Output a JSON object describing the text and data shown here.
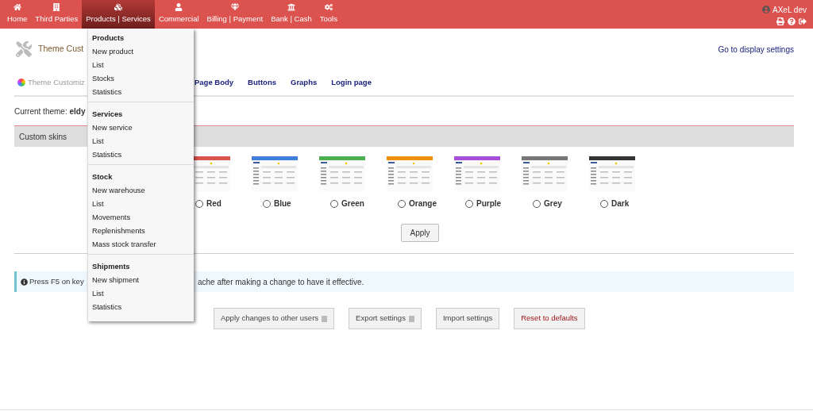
{
  "topbar": {
    "menus": [
      {
        "label": "Home",
        "selected": false
      },
      {
        "label": "Third Parties",
        "selected": false
      },
      {
        "label": "Products | Services",
        "selected": true
      },
      {
        "label": "Commercial",
        "selected": false
      },
      {
        "label": "Billing | Payment",
        "selected": false
      },
      {
        "label": "Bank | Cash",
        "selected": false
      },
      {
        "label": "Tools",
        "selected": false
      }
    ],
    "user": "AXeL dev"
  },
  "page": {
    "title": "Theme Cust",
    "display_settings_link": "Go to display settings",
    "tabs": [
      {
        "label": "Theme Customiz",
        "selected": true
      },
      {
        "label": "Page Body",
        "selected": false
      },
      {
        "label": "Buttons",
        "selected": false
      },
      {
        "label": "Graphs",
        "selected": false
      },
      {
        "label": "Login page",
        "selected": false
      }
    ],
    "current_theme_label": "Current theme:",
    "current_theme": "eldy",
    "section_title": "Custom skins",
    "skins": [
      {
        "label": "Red",
        "color": "#d9534f",
        "selected": false
      },
      {
        "label": "Blue",
        "color": "#3f7fd9",
        "selected": false
      },
      {
        "label": "Green",
        "color": "#4caf50",
        "selected": false
      },
      {
        "label": "Orange",
        "color": "#f0900f",
        "selected": false
      },
      {
        "label": "Purple",
        "color": "#a64ed9",
        "selected": false
      },
      {
        "label": "Grey",
        "color": "#777777",
        "selected": false
      },
      {
        "label": "Dark",
        "color": "#333333",
        "selected": false
      }
    ],
    "apply_button": "Apply",
    "info_left": "Press F5 on key",
    "info_right": "ache after making a change to have it effective.",
    "buttons": [
      {
        "label": "Apply changes to other users",
        "help": true,
        "kind": "normal"
      },
      {
        "label": "Export settings",
        "help": true,
        "kind": "normal"
      },
      {
        "label": "Import settings",
        "help": false,
        "kind": "normal"
      },
      {
        "label": "Reset to defaults",
        "help": false,
        "kind": "danger"
      }
    ]
  },
  "dropdown": {
    "sections": [
      {
        "title": "Products",
        "items": [
          "New product",
          "List",
          "Stocks",
          "Statistics"
        ]
      },
      {
        "title": "Services",
        "items": [
          "New service",
          "List",
          "Statistics"
        ]
      },
      {
        "title": "Stock",
        "items": [
          "New warehouse",
          "List",
          "Movements",
          "Replenishments",
          "Mass stock transfer"
        ]
      },
      {
        "title": "Shipments",
        "items": [
          "New shipment",
          "List",
          "Statistics"
        ]
      }
    ]
  }
}
